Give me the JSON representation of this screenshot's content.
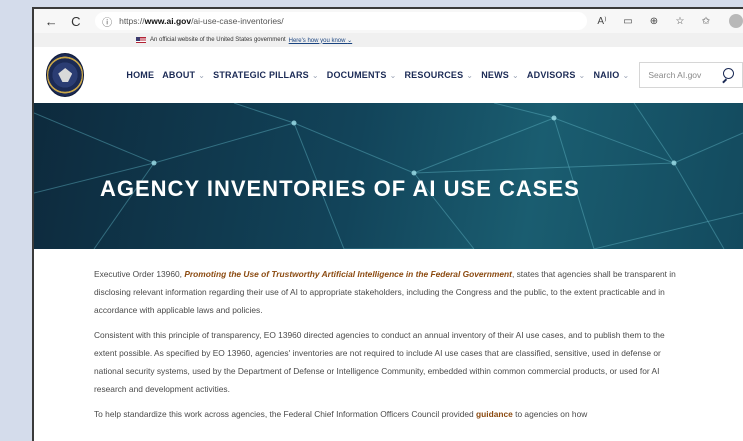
{
  "browser": {
    "url_prefix": "https://",
    "url_domain": "www.ai.gov",
    "url_path": "/ai-use-case-inventories/",
    "back_glyph": "←",
    "reload_glyph": "C",
    "site_info_glyph": "ⓘ"
  },
  "gov_banner": {
    "text": "An official website of the United States government",
    "link": "Here's how you know",
    "chevron": "⌄"
  },
  "nav": {
    "items": [
      {
        "label": "HOME",
        "chevron": ""
      },
      {
        "label": "ABOUT",
        "chevron": "⌄"
      },
      {
        "label": "STRATEGIC PILLARS",
        "chevron": "⌄"
      },
      {
        "label": "DOCUMENTS",
        "chevron": "⌄"
      },
      {
        "label": "RESOURCES",
        "chevron": "⌄"
      },
      {
        "label": "NEWS",
        "chevron": "⌄"
      },
      {
        "label": "ADVISORS",
        "chevron": "⌄"
      },
      {
        "label": "NAIIO",
        "chevron": "⌄"
      }
    ],
    "search_placeholder": "Search AI.gov"
  },
  "hero": {
    "title": "AGENCY INVENTORIES OF AI USE CASES"
  },
  "content": {
    "p1_a": "Executive Order 13960, ",
    "p1_link": "Promoting the Use of Trustworthy Artificial Intelligence in the Federal Government",
    "p1_b": ", states that agencies shall be transparent in disclosing relevant information regarding their use of AI to appropriate stakeholders, including the Congress and the public, to the extent practicable and in accordance with applicable laws and policies.",
    "p2": "Consistent with this principle of transparency, EO 13960 directed agencies to conduct an annual inventory of their AI use cases, and to publish them to the extent possible. As specified by EO 13960, agencies' inventories are not required to include AI use cases that are classified, sensitive, used in defense or national security systems, used by the Department of Defense or Intelligence Community, embedded within common commercial products, or used for AI research and development activities.",
    "p3_a": "To help standardize this work across agencies, the Federal Chief Information Officers Council provided ",
    "p3_link": "guidance",
    "p3_b": " to agencies on how"
  },
  "colors": {
    "nav_text": "#1b2a55",
    "link_brown": "#8b4a10",
    "hero_dark": "#0d2a3d",
    "hero_mid": "#1a5d70"
  }
}
